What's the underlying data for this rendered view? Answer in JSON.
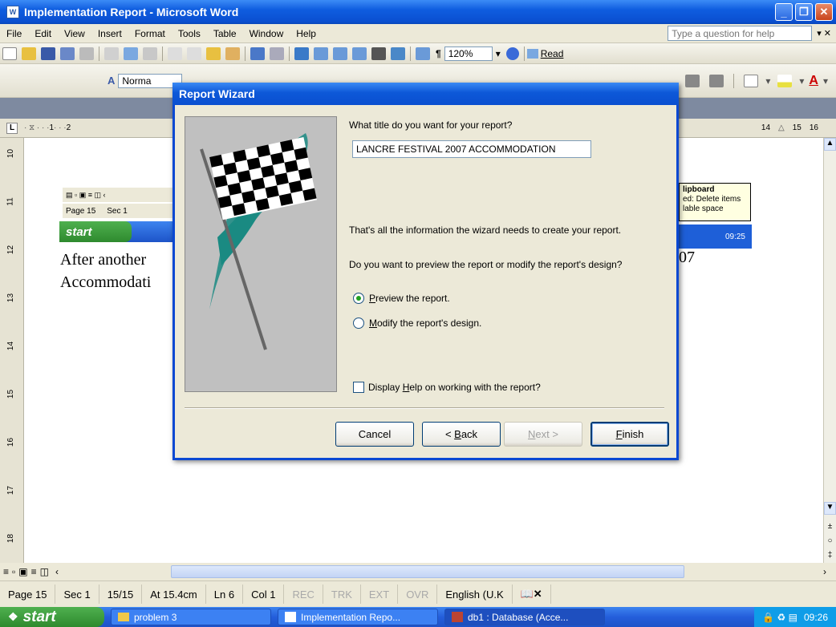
{
  "window": {
    "title": "Implementation Report - Microsoft Word",
    "icon": "W"
  },
  "menu": {
    "items": [
      "File",
      "Edit",
      "View",
      "Insert",
      "Format",
      "Tools",
      "Table",
      "Window",
      "Help"
    ],
    "ask_placeholder": "Type a question for help"
  },
  "toolbar": {
    "zoom": "120%",
    "read": "Read",
    "style": "Norma"
  },
  "ruler": {
    "left_numbers": [
      "1",
      "2"
    ],
    "right_numbers": [
      "14",
      "15",
      "16"
    ]
  },
  "vruler": {
    "numbers": [
      "10",
      "11",
      "12",
      "13",
      "14",
      "15",
      "16",
      "17",
      "18"
    ]
  },
  "inner_window": {
    "page": "Page 15",
    "sec": "Sec 1",
    "start": "start",
    "clip_title": "lipboard",
    "clip_line1": "ed: Delete items",
    "clip_line2": "lable space",
    "time": "09:25"
  },
  "document": {
    "line1": "After another",
    "line1_right": "07",
    "line2": "Accommodati"
  },
  "dialog": {
    "title": "Report Wizard",
    "question": "What title do you want for your report?",
    "report_title": "LANCRE FESTIVAL 2007 ACCOMMODATION",
    "info": "That's all the information the wizard needs to create your report.",
    "preview_question": "Do you want to preview the report or modify the report's design?",
    "option_preview": "review the report.",
    "option_preview_key": "P",
    "option_modify": "odify the report's design.",
    "option_modify_key": "M",
    "help_prefix": "Display ",
    "help_key": "H",
    "help_rest": "elp on working with the report?",
    "cancel": "Cancel",
    "back_prefix": "< ",
    "back_key": "B",
    "back_rest": "ack",
    "next_key": "N",
    "next_rest": "ext >",
    "finish_key": "F",
    "finish_rest": "inish"
  },
  "statusbar": {
    "page": "Page 15",
    "sec": "Sec 1",
    "pages": "15/15",
    "at": "At 15.4cm",
    "ln": "Ln 6",
    "col": "Col 1",
    "rec": "REC",
    "trk": "TRK",
    "ext": "EXT",
    "ovr": "OVR",
    "lang": "English (U.K"
  },
  "taskbar": {
    "start": "start",
    "tasks": [
      "problem 3",
      "Implementation Repo...",
      "db1 : Database (Acce..."
    ],
    "time": "09:26"
  }
}
